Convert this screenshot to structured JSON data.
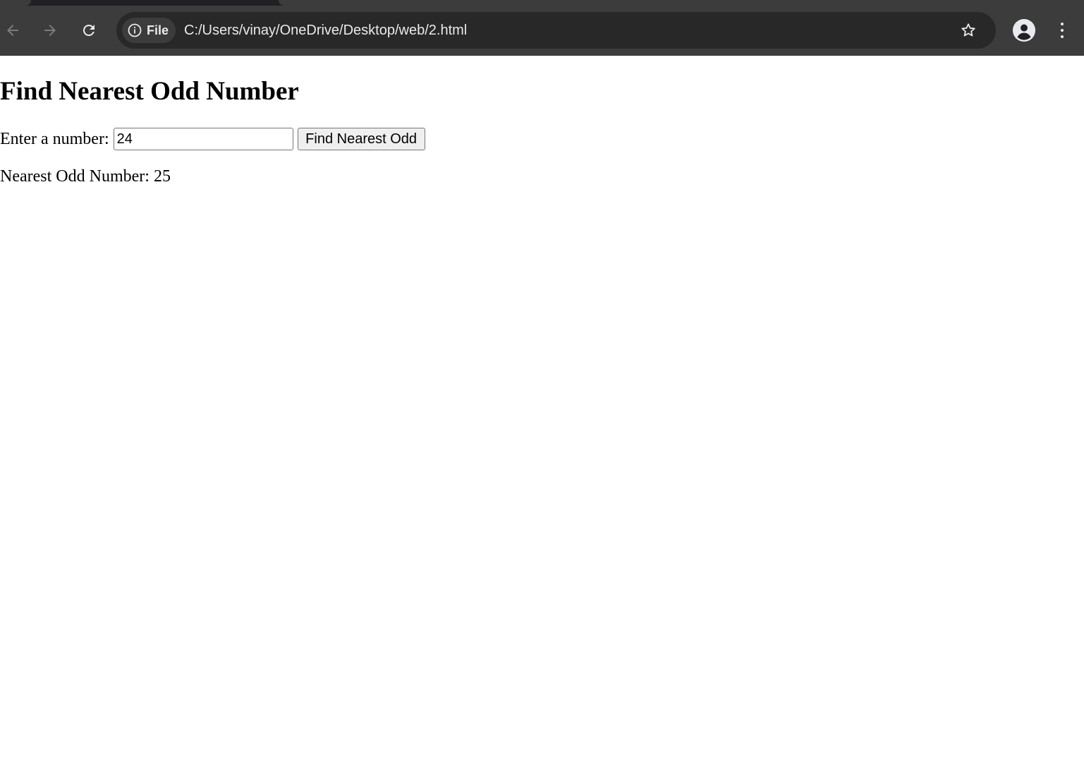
{
  "browser": {
    "site_chip_label": "File",
    "url": "C:/Users/vinay/OneDrive/Desktop/web/2.html"
  },
  "page": {
    "title": "Find Nearest Odd Number",
    "input_label": "Enter a number:",
    "input_value": "24",
    "button_label": "Find Nearest Odd",
    "result_label": "Nearest Odd Number:",
    "result_value": "25"
  }
}
